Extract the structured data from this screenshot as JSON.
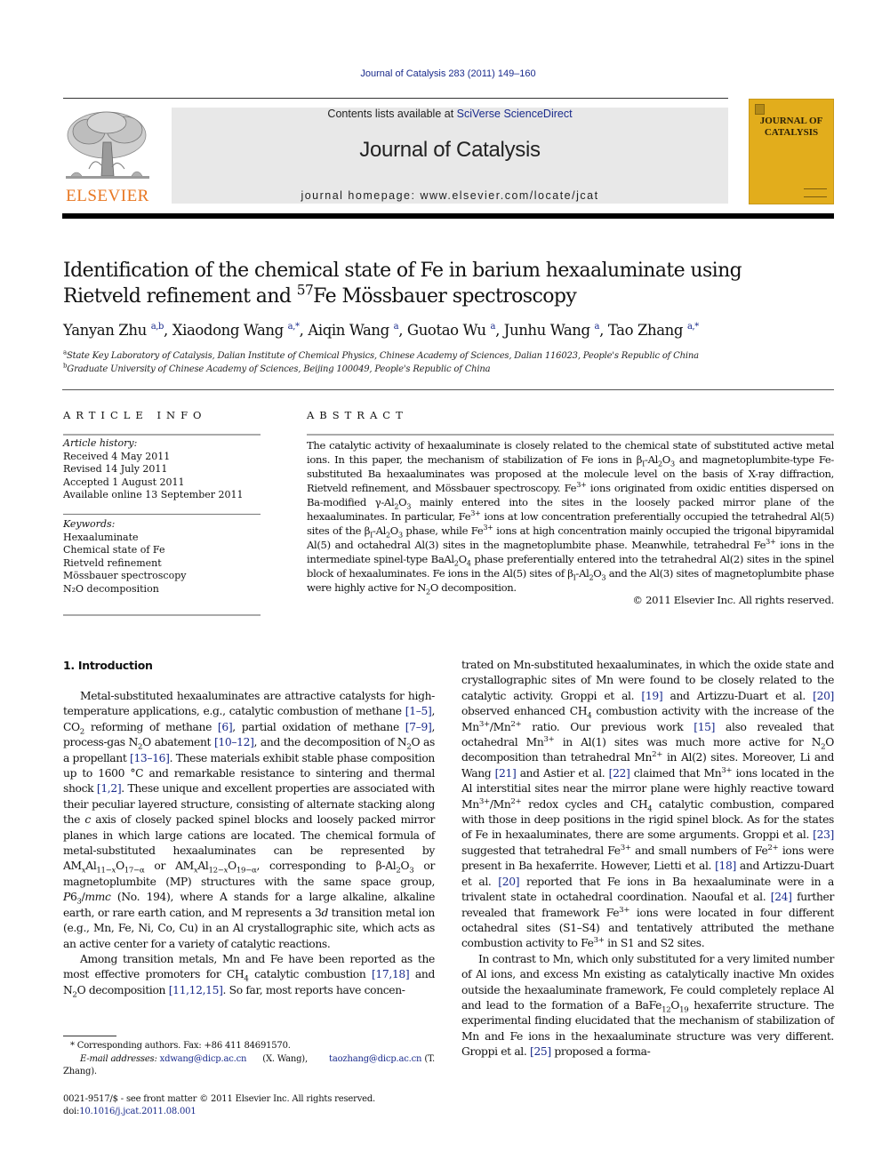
{
  "header": {
    "journal_citation": "Journal of Catalysis 283 (2011) 149–160",
    "contents_prefix": "Contents lists available at ",
    "sciencedirect_link": "SciVerse ScienceDirect",
    "journal_title": "Journal of Catalysis",
    "homepage_prefix": "journal homepage: ",
    "homepage_url": "www.elsevier.com/locate/jcat",
    "publisher_logo_text": "ELSEVIER",
    "cover_title_line1": "JOURNAL OF",
    "cover_title_line2": "CATALYSIS",
    "colors": {
      "publisher_orange": "#e87722",
      "cover_yellow": "#e2ad1c",
      "link_blue": "#1a2b8c"
    }
  },
  "article": {
    "title_line1": "Identification of the chemical state of Fe in barium hexaaluminate using",
    "title_line2_pre": "Rietveld refinement and ",
    "title_isotope": "57",
    "title_line2_post": "Fe Mössbauer spectroscopy",
    "authors": [
      {
        "name": "Yanyan Zhu",
        "aff": "a,b"
      },
      {
        "name": "Xiaodong Wang",
        "aff": "a,*"
      },
      {
        "name": "Aiqin Wang",
        "aff": "a"
      },
      {
        "name": "Guotao Wu",
        "aff": "a"
      },
      {
        "name": "Junhu Wang",
        "aff": "a"
      },
      {
        "name": "Tao Zhang",
        "aff": "a,*"
      }
    ],
    "affiliations": [
      {
        "mark": "a",
        "text": "State Key Laboratory of Catalysis, Dalian Institute of Chemical Physics, Chinese Academy of Sciences, Dalian 116023, People's Republic of China"
      },
      {
        "mark": "b",
        "text": "Graduate University of Chinese Academy of Sciences, Beijing 100049, People's Republic of China"
      }
    ]
  },
  "article_info": {
    "heading": "ARTICLE INFO",
    "history_label": "Article history:",
    "history": [
      "Received 4 May 2011",
      "Revised 14 July 2011",
      "Accepted 1 August 2011",
      "Available online 13 September 2011"
    ],
    "keywords_label": "Keywords:",
    "keywords": [
      "Hexaaluminate",
      "Chemical state of Fe",
      "Rietveld refinement",
      "Mössbauer spectroscopy",
      "N₂O decomposition"
    ]
  },
  "abstract": {
    "heading": "ABSTRACT",
    "copyright": "© 2011 Elsevier Inc. All rights reserved."
  },
  "intro": {
    "heading": "1. Introduction"
  },
  "footnotes": {
    "corresponding": "Corresponding authors. Fax: +86 411 84691570.",
    "email_label": "E-mail addresses:",
    "email1": "xdwang@dicp.ac.cn",
    "email1_name": "(X. Wang),",
    "email2": "taozhang@dicp.ac.cn",
    "email2_name": "(T. Zhang).",
    "issn_line": "0021-9517/$ - see front matter © 2011 Elsevier Inc. All rights reserved.",
    "doi_prefix": "doi:",
    "doi": "10.1016/j.jcat.2011.08.001"
  }
}
